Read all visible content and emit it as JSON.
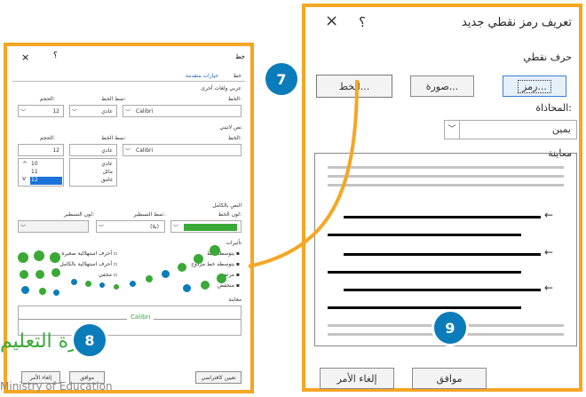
{
  "main_dialog": {
    "title": "تعريف رمز نقطي جديد",
    "help": "؟",
    "close": "×",
    "section_bullet_char": "حرف نقطي",
    "symbol_button": "رمز...",
    "picture_button": "صورة...",
    "font_button": "الخط...",
    "alignment_label": "المحاذاة:",
    "alignment_value": "يمين",
    "preview_label": "معاينة",
    "ok_button": "موافق",
    "cancel_button": "إلغاء الأمر"
  },
  "font_dialog": {
    "title": "خط",
    "help": "؟",
    "close": "×",
    "tab_font": "خط",
    "tab_advanced": "خيارات متقدمة",
    "section_complex": "عربي ولغات أخرى",
    "font_label": "الخط:",
    "style_label": "نمط الخط:",
    "size_label": "الحجم:",
    "complex_font_value": "Calibri",
    "complex_style_value": "عادي",
    "complex_size_value": "12",
    "section_latin": "نص لاتيني",
    "latin_font_value": "Calibri",
    "latin_style_value": "عادي",
    "latin_size_value": "12",
    "latin_style_options": [
      "عادي",
      "مائل",
      "غامق"
    ],
    "latin_size_options": [
      "10",
      "11",
      "12"
    ],
    "section_all_text": "النص بالكامل",
    "font_color_label": "لون الخط:",
    "underline_style_label": "نمط التسطير:",
    "underline_color_label": "لون التسطير:",
    "underline_value": "(بلا)",
    "section_effects": "تأثيرات",
    "effects": [
      "يتوسطه خط",
      "يتوسطه خط مزدوج",
      "مرتفع",
      "منخفض"
    ],
    "effects_right": [
      "أحرف استهلالية صغيرة",
      "أحرف استهلالية بالكامل",
      "مخفي"
    ],
    "section_preview": "معاينة",
    "preview_text": "Calibri",
    "set_default_button": "تعيين كافتراضي",
    "ok_button": "موافق",
    "cancel_button": "إلغاء الأمر"
  },
  "callouts": [
    "7",
    "8",
    "9"
  ],
  "watermark": {
    "line1": "وزارة التعليم",
    "line2": "Ministry of Education"
  },
  "colors": {
    "highlight": "#f5a623",
    "badge": "#0b7cba",
    "green": "#3aa935"
  }
}
